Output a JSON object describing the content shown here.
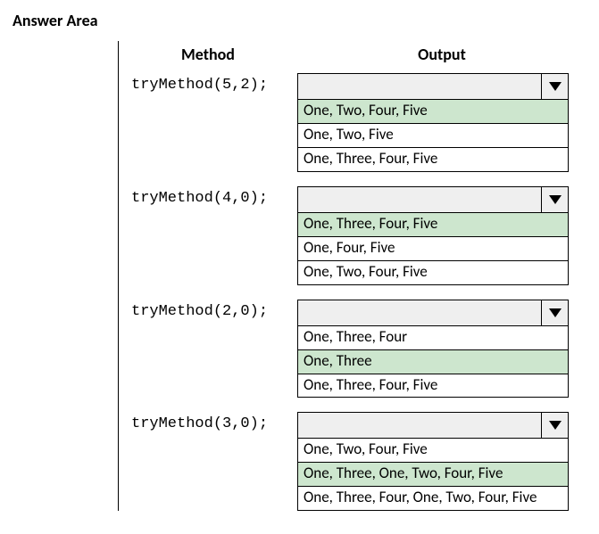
{
  "title": "Answer Area",
  "headers": {
    "method": "Method",
    "output": "Output"
  },
  "rows": [
    {
      "method": "tryMethod(5,2);",
      "options": [
        "One, Two, Four, Five",
        "One, Two, Five",
        "One, Three, Four, Five"
      ],
      "selected_index": 0
    },
    {
      "method": "tryMethod(4,0);",
      "options": [
        "One, Three, Four, Five",
        "One, Four, Five",
        "One, Two, Four, Five"
      ],
      "selected_index": 0
    },
    {
      "method": "tryMethod(2,0);",
      "options": [
        "One, Three, Four",
        "One, Three",
        "One, Three, Four, Five"
      ],
      "selected_index": 1
    },
    {
      "method": "tryMethod(3,0);",
      "options": [
        "One, Two, Four, Five",
        "One, Three, One, Two, Four, Five",
        "One, Three, Four, One, Two, Four, Five"
      ],
      "selected_index": 1
    }
  ]
}
